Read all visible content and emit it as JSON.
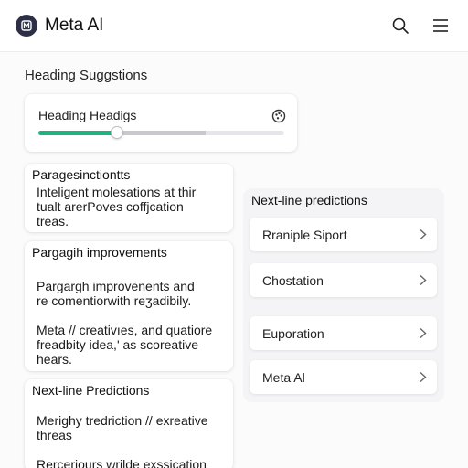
{
  "header": {
    "title": "Meta AI",
    "icons": [
      "meta-logo-icon",
      "search-icon",
      "menu-icon"
    ]
  },
  "section": {
    "title": "Heading Suggstions"
  },
  "slider": {
    "label": "Heading Headigs",
    "value_fraction": 0.32,
    "secondary_fraction": 0.68,
    "accent_color": "#1db57f"
  },
  "cards": [
    {
      "title": "Paragesinctiontts",
      "lines": [
        "Inteligent molesations at thir",
        "tualt arerPoves coffjcation",
        "treas."
      ]
    },
    {
      "title": "Pargagih improvements",
      "lines": [
        "Pargargh improvenents and",
        "re comentiorwith reʒadibily.",
        "Meta // creativıes, and quatiore",
        "freadbity idea,' as scoreative",
        "hears."
      ]
    },
    {
      "title": "Next-line Predictions",
      "lines": [
        "Merighy tredriction // exreative",
        "threas",
        "Rercerjours wrilde exssication"
      ]
    }
  ],
  "right_panel": {
    "title": "Next-line predictions",
    "items": [
      {
        "label": "Rraniple Siport"
      },
      {
        "label": "Chostation"
      },
      {
        "label": "Euporation"
      },
      {
        "label": "Meta Al"
      }
    ]
  }
}
